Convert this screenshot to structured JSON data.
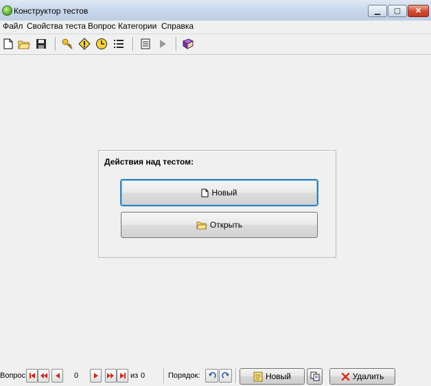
{
  "window": {
    "title": "Конструктор тестов",
    "controls": {
      "minimize": "minimize-icon",
      "maximize": "maximize-icon",
      "close": "close-icon"
    }
  },
  "menu": {
    "items": [
      "Файл",
      "Свойства теста",
      "Вопрос",
      "Категории",
      "Справка"
    ]
  },
  "toolbar": {
    "icons": [
      "new-document-icon",
      "open-folder-icon",
      "save-icon",
      "key-icon",
      "warning-icon",
      "clock-icon",
      "list-icon",
      "notes-icon",
      "play-icon",
      "book-icon"
    ]
  },
  "panel": {
    "title": "Действия над тестом:",
    "new_label": "Новый",
    "open_label": "Открыть"
  },
  "bottom": {
    "question_label": "Вопрос:",
    "current": "0",
    "of_label": "из",
    "total": "0",
    "order_label": "Порядок:",
    "new_label": "Новый",
    "delete_label": "Удалить"
  },
  "colors": {
    "nav_red": "#c8281e",
    "delete_red": "#d32c1c",
    "accent_blue": "#3c7fb1"
  }
}
